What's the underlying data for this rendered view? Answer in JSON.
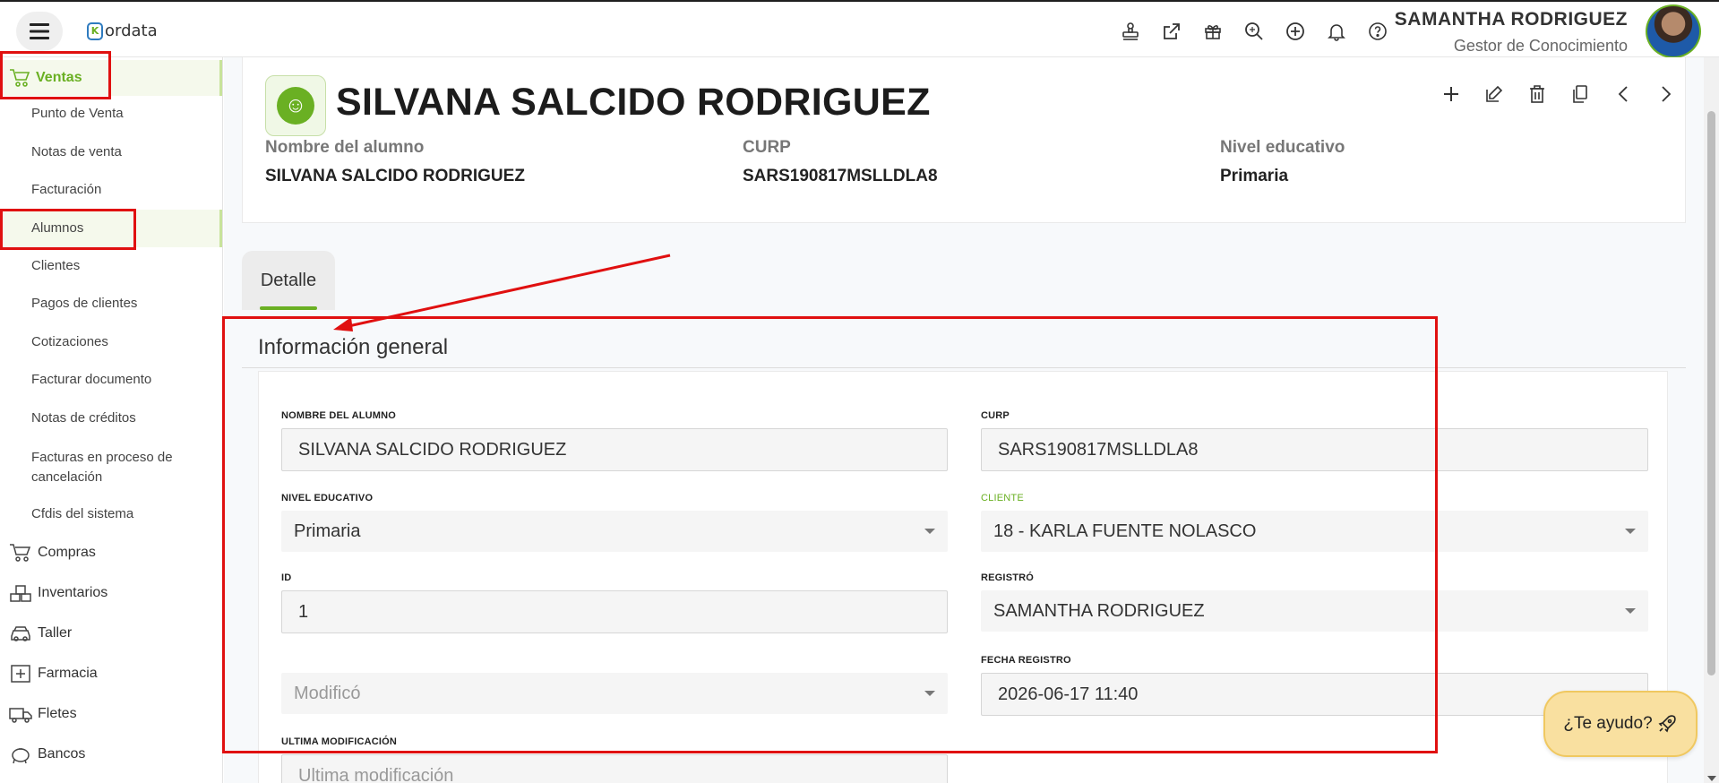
{
  "topbar": {
    "logo_text": "ordata",
    "logo_mark": "K",
    "icons": [
      "stamp-icon",
      "external-link-icon",
      "gift-icon",
      "zoom-search-icon",
      "add-circle-icon",
      "bell-icon",
      "help-icon"
    ],
    "user_name": "SAMANTHA RODRIGUEZ",
    "user_role": "Gestor de Conocimiento"
  },
  "sidebar": {
    "section": "Ventas",
    "items": [
      "Punto de Venta",
      "Notas de venta",
      "Facturación",
      "Alumnos",
      "Clientes",
      "Pagos de clientes",
      "Cotizaciones",
      "Facturar documento",
      "Notas de créditos",
      "Facturas en proceso de cancelación",
      "Cfdis del sistema"
    ],
    "active_item": "Alumnos",
    "groups": [
      "Compras",
      "Inventarios",
      "Taller",
      "Farmacia",
      "Fletes",
      "Bancos"
    ]
  },
  "header": {
    "title": "SILVANA SALCIDO RODRIGUEZ",
    "fields": [
      {
        "label": "Nombre del alumno",
        "value": "SILVANA SALCIDO RODRIGUEZ"
      },
      {
        "label": "CURP",
        "value": "SARS190817MSLLDLA8"
      },
      {
        "label": "Nivel educativo",
        "value": "Primaria"
      }
    ],
    "actions": [
      "add-icon",
      "edit-icon",
      "delete-icon",
      "copy-icon",
      "prev-icon",
      "next-icon"
    ]
  },
  "tabs": [
    {
      "label": "Detalle",
      "active": true
    }
  ],
  "form": {
    "section_title": "Información general",
    "nombre": {
      "label": "NOMBRE DEL ALUMNO",
      "value": "SILVANA SALCIDO RODRIGUEZ"
    },
    "curp": {
      "label": "CURP",
      "value": "SARS190817MSLLDLA8"
    },
    "nivel": {
      "label": "NIVEL EDUCATIVO",
      "value": "Primaria"
    },
    "cliente": {
      "label": "CLIENTE",
      "value": "18 - KARLA FUENTE NOLASCO"
    },
    "id": {
      "label": "ID",
      "value": "1"
    },
    "registro": {
      "label": "REGISTRÓ",
      "value": "SAMANTHA RODRIGUEZ"
    },
    "modifico": {
      "label": "",
      "placeholder": "Modificó"
    },
    "fecha_registro": {
      "label": "FECHA REGISTRO",
      "value": "2026-06-17 11:40"
    },
    "ultima_mod": {
      "label": "ULTIMA MODIFICACIÓN",
      "placeholder": "Ultima modificación"
    }
  },
  "help": {
    "label": "¿Te ayudo?"
  },
  "colors": {
    "accent": "#6ab023",
    "annotation": "#e01010"
  }
}
